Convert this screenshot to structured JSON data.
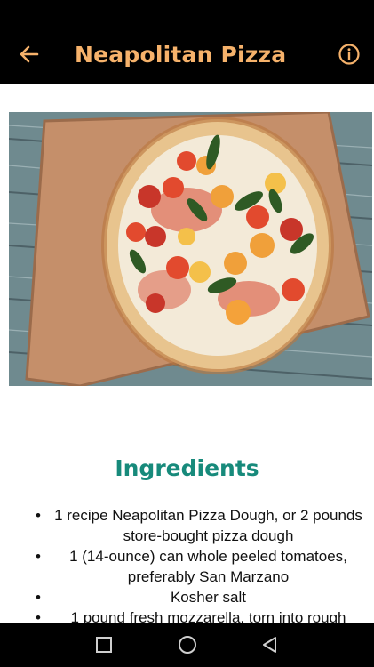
{
  "appbar": {
    "title": "Neapolitan Pizza",
    "back_icon": "arrow-left-icon",
    "info_icon": "info-icon",
    "accent": "#f6b26b",
    "background": "#000000"
  },
  "hero": {
    "image": "pizza-photo"
  },
  "ingredients": {
    "heading": "Ingredients",
    "heading_color": "#178a7b",
    "items": [
      {
        "label": "1 recipe Neapolitan Pizza Dough, or 2 pounds store-bought pizza dough"
      },
      {
        "label": "1 (14-ounce) can whole peeled tomatoes, preferably San Marzano"
      },
      {
        "label": "Kosher salt"
      },
      {
        "label": "1 pound fresh mozzarella, torn into rough"
      }
    ]
  },
  "navbar": {
    "recents_icon": "square-icon",
    "home_icon": "circle-icon",
    "back_icon": "triangle-back-icon"
  }
}
